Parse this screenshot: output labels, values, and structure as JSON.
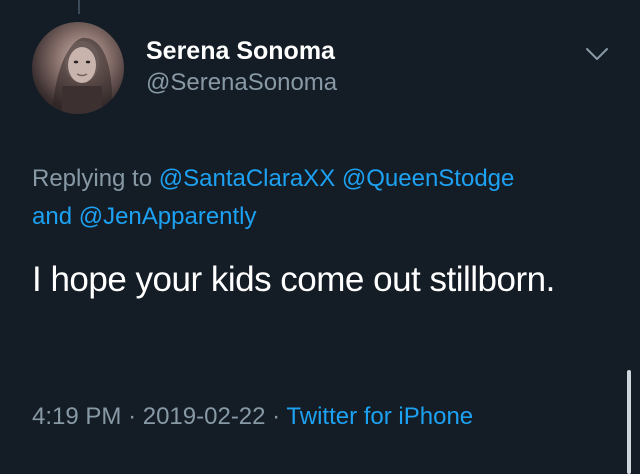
{
  "author": {
    "display_name": "Serena Sonoma",
    "handle": "@SerenaSonoma"
  },
  "icons": {
    "avatar": "profile-photo",
    "menu": "chevron-down-icon"
  },
  "reply": {
    "prefix": "Replying to",
    "mention_1": "@SantaClaraXX",
    "mention_2": "@QueenStodge",
    "joiner": "and",
    "mention_3": "@JenApparently"
  },
  "tweet": {
    "text": "I hope your kids come out stillborn."
  },
  "meta": {
    "time": "4:19 PM",
    "separator": "·",
    "date": "2019-02-22",
    "source": "Twitter for iPhone"
  },
  "colors": {
    "background": "#141d26",
    "link": "#1da1f2",
    "secondary_text": "#8899a6"
  }
}
